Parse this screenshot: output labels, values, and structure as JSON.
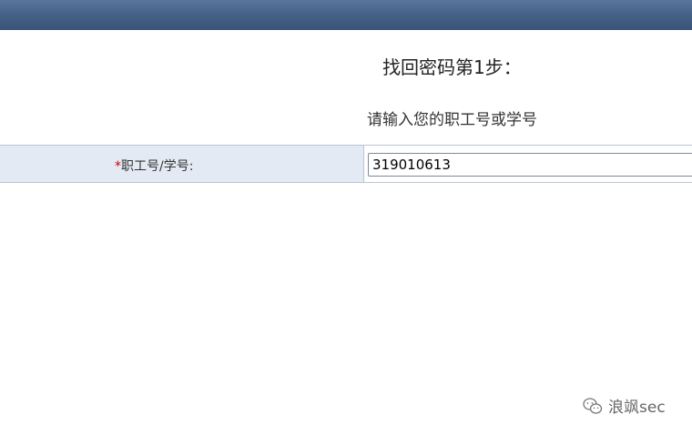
{
  "header": {
    "title": "找回密码第1步：",
    "subtitle": "请输入您的职工号或学号"
  },
  "form": {
    "required_mark": "*",
    "id_label": "职工号/学号:",
    "id_value": "319010613"
  },
  "watermark": {
    "text": "浪飒sec",
    "icon": "wechat-icon"
  },
  "colors": {
    "topbar": "#425f85",
    "label_bg": "#e3eaf3",
    "required": "#cc0000"
  }
}
